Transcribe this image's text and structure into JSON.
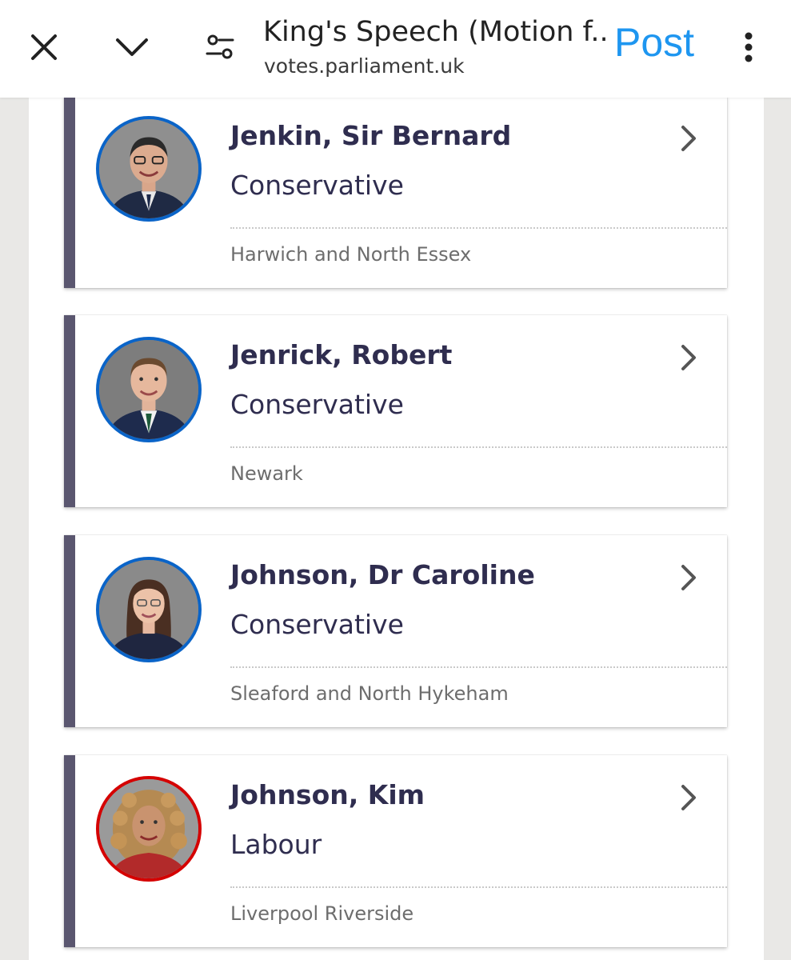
{
  "topbar": {
    "title": "King's Speech (Motion f...",
    "url": "votes.parliament.uk",
    "post_label": "Post",
    "icons": [
      "close-icon",
      "chevron-down-icon",
      "settings-sliders-icon",
      "more-vertical-icon"
    ],
    "accent_color": "#1e96f0"
  },
  "members": [
    {
      "name": "Jenkin, Sir Bernard",
      "party": "Conservative",
      "constituency": "Harwich and North Essex",
      "party_color": "#0a64c8"
    },
    {
      "name": "Jenrick, Robert",
      "party": "Conservative",
      "constituency": "Newark",
      "party_color": "#0a64c8"
    },
    {
      "name": "Johnson, Dr Caroline",
      "party": "Conservative",
      "constituency": "Sleaford and North Hykeham",
      "party_color": "#0a64c8"
    },
    {
      "name": "Johnson, Kim",
      "party": "Labour",
      "constituency": "Liverpool Riverside",
      "party_color": "#d50000"
    }
  ]
}
